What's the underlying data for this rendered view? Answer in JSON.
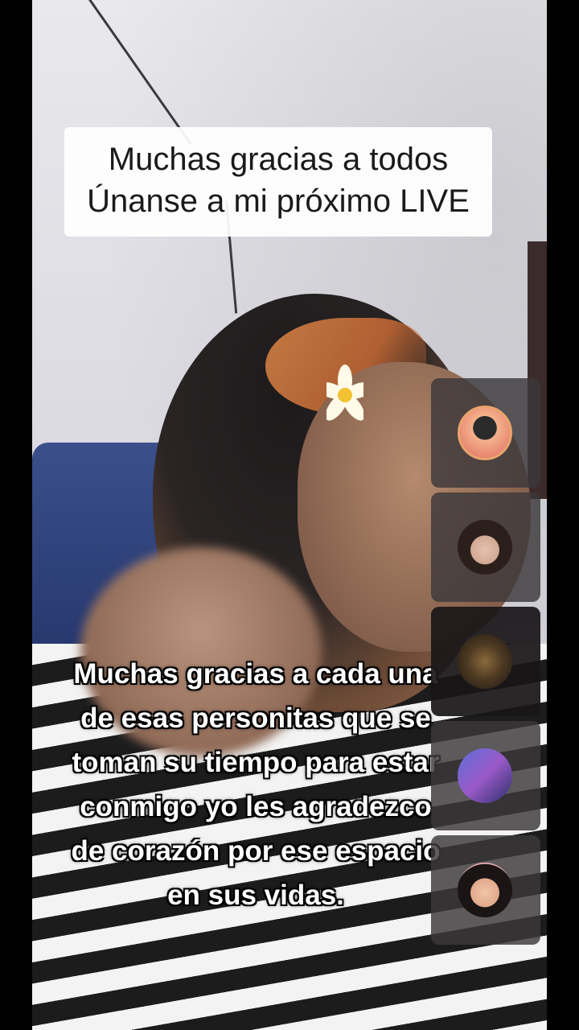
{
  "caption_top": {
    "line1": "Muchas gracias a todos",
    "line2": "Únanse a mi próximo LIVE"
  },
  "caption_bottom": {
    "lines": [
      "Muchas gracias a cada una",
      "de esas personitas que se",
      "toman su tiempo para estar",
      "conmigo yo les agradezco",
      "de corazón por ese espacio",
      "en sus vidas."
    ]
  },
  "guests": [
    {
      "avatar": "cartoon-avatar"
    },
    {
      "avatar": "woman-portrait-avatar"
    },
    {
      "avatar": "dark-photo-avatar"
    },
    {
      "avatar": "selfie-avatar"
    },
    {
      "avatar": "woman-smiling-avatar"
    }
  ]
}
